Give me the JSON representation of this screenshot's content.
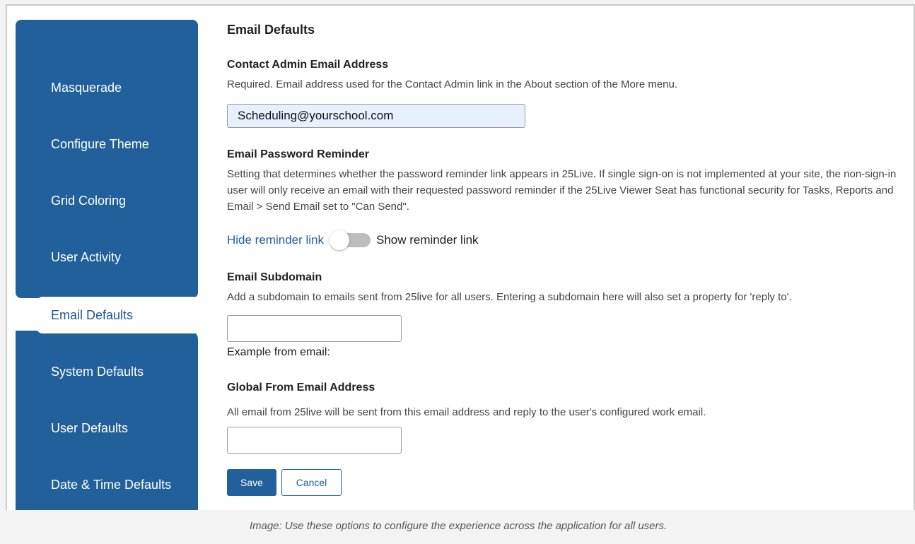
{
  "sidebar": {
    "items": [
      {
        "label": "Masquerade",
        "active": false
      },
      {
        "label": "Configure Theme",
        "active": false
      },
      {
        "label": "Grid Coloring",
        "active": false
      },
      {
        "label": "User Activity",
        "active": false
      },
      {
        "label": "Email Defaults",
        "active": true
      },
      {
        "label": "System Defaults",
        "active": false
      },
      {
        "label": "User Defaults",
        "active": false
      },
      {
        "label": "Date & Time Defaults",
        "active": false
      }
    ]
  },
  "main": {
    "title": "Email Defaults",
    "contact_admin": {
      "heading": "Contact Admin Email Address",
      "description": "Required. Email address used for the Contact Admin link in the About section of the More menu.",
      "value": "Scheduling@yourschool.com"
    },
    "password_reminder": {
      "heading": "Email Password Reminder",
      "description": "Setting that determines whether the password reminder link appears in 25Live. If single sign-on is not implemented at your site, the non-sign-in user will only receive an email with their requested password reminder if the 25Live Viewer Seat has functional security for Tasks, Reports and Email > Send Email set to \"Can Send\".",
      "off_label": "Hide reminder link",
      "on_label": "Show reminder link",
      "state": "off"
    },
    "subdomain": {
      "heading": "Email Subdomain",
      "description": "Add a subdomain to emails sent from 25live for all users. Entering a subdomain here will also set a property for 'reply to'.",
      "value": "",
      "example_label": "Example from email:"
    },
    "global_from": {
      "heading": "Global From Email Address",
      "description": "All email from 25live will be sent from this email address and reply to the user's configured work email.",
      "value": ""
    },
    "save_label": "Save",
    "cancel_label": "Cancel"
  },
  "caption": "Image: Use these options to configure the experience across the application for all users.",
  "colors": {
    "sidebar": "#21609a",
    "link": "#1f5fa0",
    "autofill": "#e8f0fe"
  }
}
